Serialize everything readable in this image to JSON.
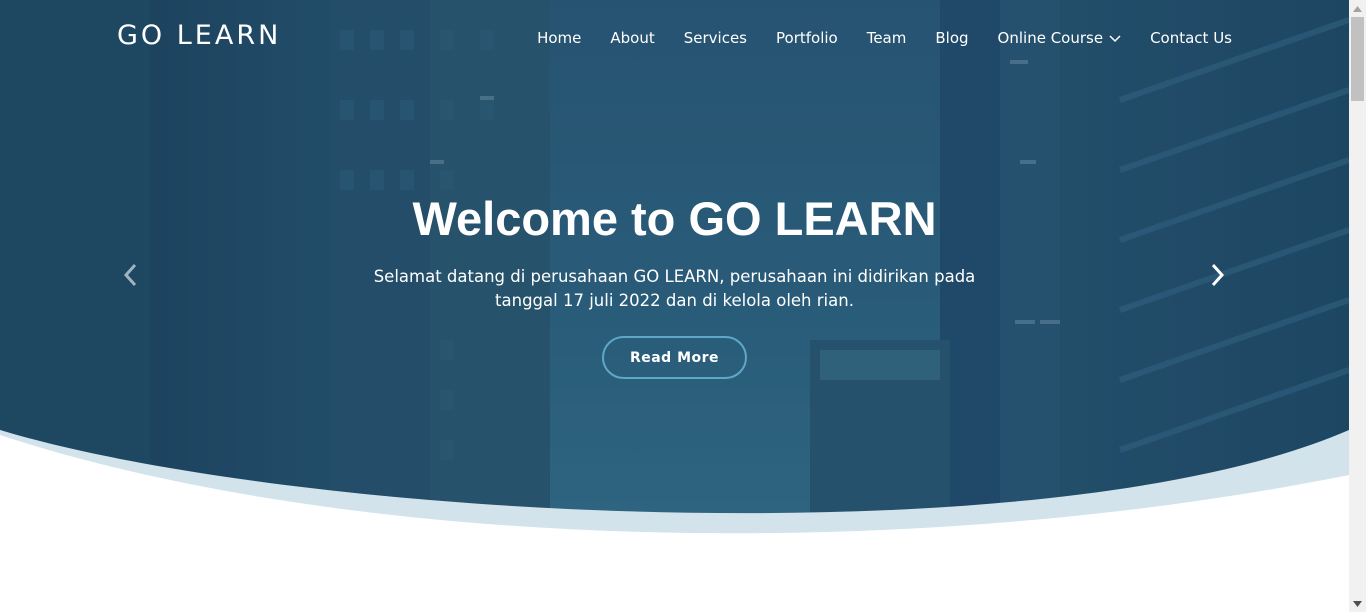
{
  "brand": {
    "logo": "GO LEARN"
  },
  "nav": {
    "items": [
      {
        "label": "Home"
      },
      {
        "label": "About"
      },
      {
        "label": "Services"
      },
      {
        "label": "Portfolio"
      },
      {
        "label": "Team"
      },
      {
        "label": "Blog"
      },
      {
        "label": "Online Course",
        "icon": "chevron-down-icon"
      },
      {
        "label": "Contact Us"
      }
    ]
  },
  "hero": {
    "title": "Welcome to GO LEARN",
    "subtitle": "Selamat datang di perusahaan GO LEARN, perusahaan ini didirikan pada tanggal 17 juli 2022 dan di kelola oleh rian.",
    "cta_label": "Read More",
    "prev_icon": "chevron-left-icon",
    "next_icon": "chevron-right-icon"
  },
  "colors": {
    "hero_overlay": "#1f4a66",
    "wave_light": "#d2e3ec",
    "cta_border": "#5fa7c8",
    "text": "#ffffff"
  }
}
